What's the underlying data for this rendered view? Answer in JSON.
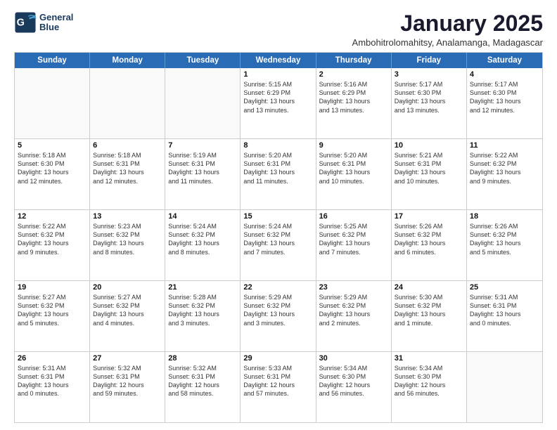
{
  "logo": {
    "line1": "General",
    "line2": "Blue"
  },
  "title": "January 2025",
  "subtitle": "Ambohitrolomahitsy, Analamanga, Madagascar",
  "days_of_week": [
    "Sunday",
    "Monday",
    "Tuesday",
    "Wednesday",
    "Thursday",
    "Friday",
    "Saturday"
  ],
  "weeks": [
    [
      {
        "day": "",
        "info": "",
        "empty": true
      },
      {
        "day": "",
        "info": "",
        "empty": true
      },
      {
        "day": "",
        "info": "",
        "empty": true
      },
      {
        "day": "1",
        "info": "Sunrise: 5:15 AM\nSunset: 6:29 PM\nDaylight: 13 hours\nand 13 minutes."
      },
      {
        "day": "2",
        "info": "Sunrise: 5:16 AM\nSunset: 6:29 PM\nDaylight: 13 hours\nand 13 minutes."
      },
      {
        "day": "3",
        "info": "Sunrise: 5:17 AM\nSunset: 6:30 PM\nDaylight: 13 hours\nand 13 minutes."
      },
      {
        "day": "4",
        "info": "Sunrise: 5:17 AM\nSunset: 6:30 PM\nDaylight: 13 hours\nand 12 minutes."
      }
    ],
    [
      {
        "day": "5",
        "info": "Sunrise: 5:18 AM\nSunset: 6:30 PM\nDaylight: 13 hours\nand 12 minutes."
      },
      {
        "day": "6",
        "info": "Sunrise: 5:18 AM\nSunset: 6:31 PM\nDaylight: 13 hours\nand 12 minutes."
      },
      {
        "day": "7",
        "info": "Sunrise: 5:19 AM\nSunset: 6:31 PM\nDaylight: 13 hours\nand 11 minutes."
      },
      {
        "day": "8",
        "info": "Sunrise: 5:20 AM\nSunset: 6:31 PM\nDaylight: 13 hours\nand 11 minutes."
      },
      {
        "day": "9",
        "info": "Sunrise: 5:20 AM\nSunset: 6:31 PM\nDaylight: 13 hours\nand 10 minutes."
      },
      {
        "day": "10",
        "info": "Sunrise: 5:21 AM\nSunset: 6:31 PM\nDaylight: 13 hours\nand 10 minutes."
      },
      {
        "day": "11",
        "info": "Sunrise: 5:22 AM\nSunset: 6:32 PM\nDaylight: 13 hours\nand 9 minutes."
      }
    ],
    [
      {
        "day": "12",
        "info": "Sunrise: 5:22 AM\nSunset: 6:32 PM\nDaylight: 13 hours\nand 9 minutes."
      },
      {
        "day": "13",
        "info": "Sunrise: 5:23 AM\nSunset: 6:32 PM\nDaylight: 13 hours\nand 8 minutes."
      },
      {
        "day": "14",
        "info": "Sunrise: 5:24 AM\nSunset: 6:32 PM\nDaylight: 13 hours\nand 8 minutes."
      },
      {
        "day": "15",
        "info": "Sunrise: 5:24 AM\nSunset: 6:32 PM\nDaylight: 13 hours\nand 7 minutes."
      },
      {
        "day": "16",
        "info": "Sunrise: 5:25 AM\nSunset: 6:32 PM\nDaylight: 13 hours\nand 7 minutes."
      },
      {
        "day": "17",
        "info": "Sunrise: 5:26 AM\nSunset: 6:32 PM\nDaylight: 13 hours\nand 6 minutes."
      },
      {
        "day": "18",
        "info": "Sunrise: 5:26 AM\nSunset: 6:32 PM\nDaylight: 13 hours\nand 5 minutes."
      }
    ],
    [
      {
        "day": "19",
        "info": "Sunrise: 5:27 AM\nSunset: 6:32 PM\nDaylight: 13 hours\nand 5 minutes."
      },
      {
        "day": "20",
        "info": "Sunrise: 5:27 AM\nSunset: 6:32 PM\nDaylight: 13 hours\nand 4 minutes."
      },
      {
        "day": "21",
        "info": "Sunrise: 5:28 AM\nSunset: 6:32 PM\nDaylight: 13 hours\nand 3 minutes."
      },
      {
        "day": "22",
        "info": "Sunrise: 5:29 AM\nSunset: 6:32 PM\nDaylight: 13 hours\nand 3 minutes."
      },
      {
        "day": "23",
        "info": "Sunrise: 5:29 AM\nSunset: 6:32 PM\nDaylight: 13 hours\nand 2 minutes."
      },
      {
        "day": "24",
        "info": "Sunrise: 5:30 AM\nSunset: 6:32 PM\nDaylight: 13 hours\nand 1 minute."
      },
      {
        "day": "25",
        "info": "Sunrise: 5:31 AM\nSunset: 6:31 PM\nDaylight: 13 hours\nand 0 minutes."
      }
    ],
    [
      {
        "day": "26",
        "info": "Sunrise: 5:31 AM\nSunset: 6:31 PM\nDaylight: 13 hours\nand 0 minutes."
      },
      {
        "day": "27",
        "info": "Sunrise: 5:32 AM\nSunset: 6:31 PM\nDaylight: 12 hours\nand 59 minutes."
      },
      {
        "day": "28",
        "info": "Sunrise: 5:32 AM\nSunset: 6:31 PM\nDaylight: 12 hours\nand 58 minutes."
      },
      {
        "day": "29",
        "info": "Sunrise: 5:33 AM\nSunset: 6:31 PM\nDaylight: 12 hours\nand 57 minutes."
      },
      {
        "day": "30",
        "info": "Sunrise: 5:34 AM\nSunset: 6:30 PM\nDaylight: 12 hours\nand 56 minutes."
      },
      {
        "day": "31",
        "info": "Sunrise: 5:34 AM\nSunset: 6:30 PM\nDaylight: 12 hours\nand 56 minutes."
      },
      {
        "day": "",
        "info": "",
        "empty": true
      }
    ]
  ]
}
